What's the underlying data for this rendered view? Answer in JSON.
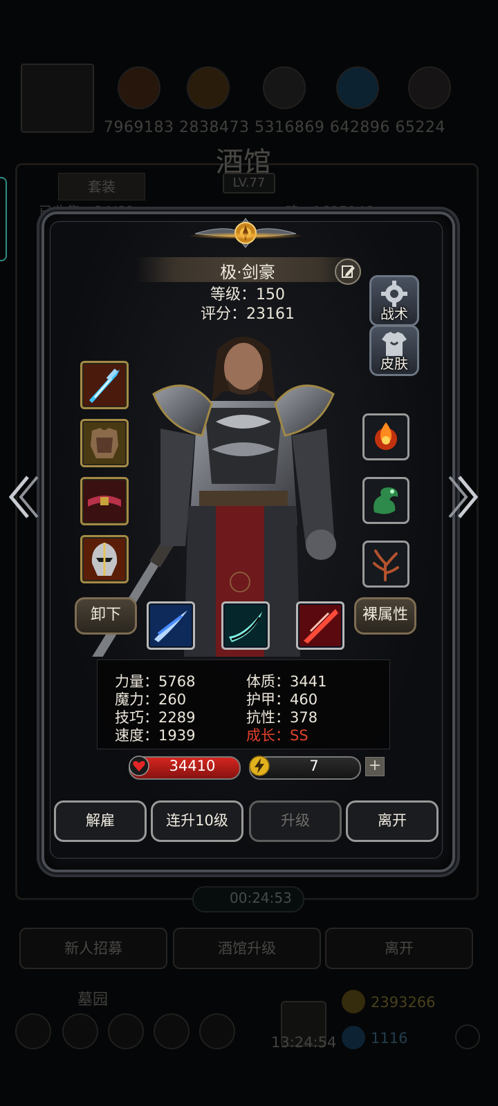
{
  "background": {
    "resource_numbers": "7969183 2838473 5316869 642896 65224",
    "title": "酒馆",
    "level": "LV.77",
    "tab_suit": "套装",
    "row_text_left": "已收集：34/60",
    "row_text_right": "魂：1615148",
    "timer": "00:24:53",
    "buttons": [
      "新人招募",
      "酒馆升级",
      "离开"
    ],
    "cemetery_label": "墓园",
    "gift_timer": "13:24:54",
    "gold_amount": "2393266",
    "gem_amount": "1116"
  },
  "hero": {
    "name": "极·剑豪",
    "level_text": "等级：150",
    "score_text": "评分：23161"
  },
  "side_buttons": {
    "tactics": "战术",
    "skin": "皮肤"
  },
  "equipment_left": [
    "ice-sword-icon",
    "armor-icon",
    "belt-icon",
    "helmet-icon"
  ],
  "equipment_right": [
    "fire-orb-icon",
    "jade-dragon-icon",
    "antler-icon"
  ],
  "buttons": {
    "unequip": "卸下",
    "base_attrs": "裸属性"
  },
  "skills": [
    "blue-slash-skill-icon",
    "teal-slash-skill-icon",
    "red-slash-skill-icon"
  ],
  "stats": {
    "strength": "力量：5768",
    "constitution": "体质：3441",
    "magic": "魔力：260",
    "armor": "护甲：460",
    "skill": "技巧：2289",
    "resistance": "抗性：378",
    "speed": "速度：1939",
    "growth": "成长：SS"
  },
  "hp": "34410",
  "energy": {
    "value": "7",
    "fill_fraction": 0.1
  },
  "actions": {
    "dismiss": "解雇",
    "level_up_10": "连升10级",
    "level_up": "升级",
    "leave": "离开"
  },
  "colors": {
    "growth": "#e0412b",
    "hp": "#d6261f",
    "energy": "#f4d64a"
  }
}
